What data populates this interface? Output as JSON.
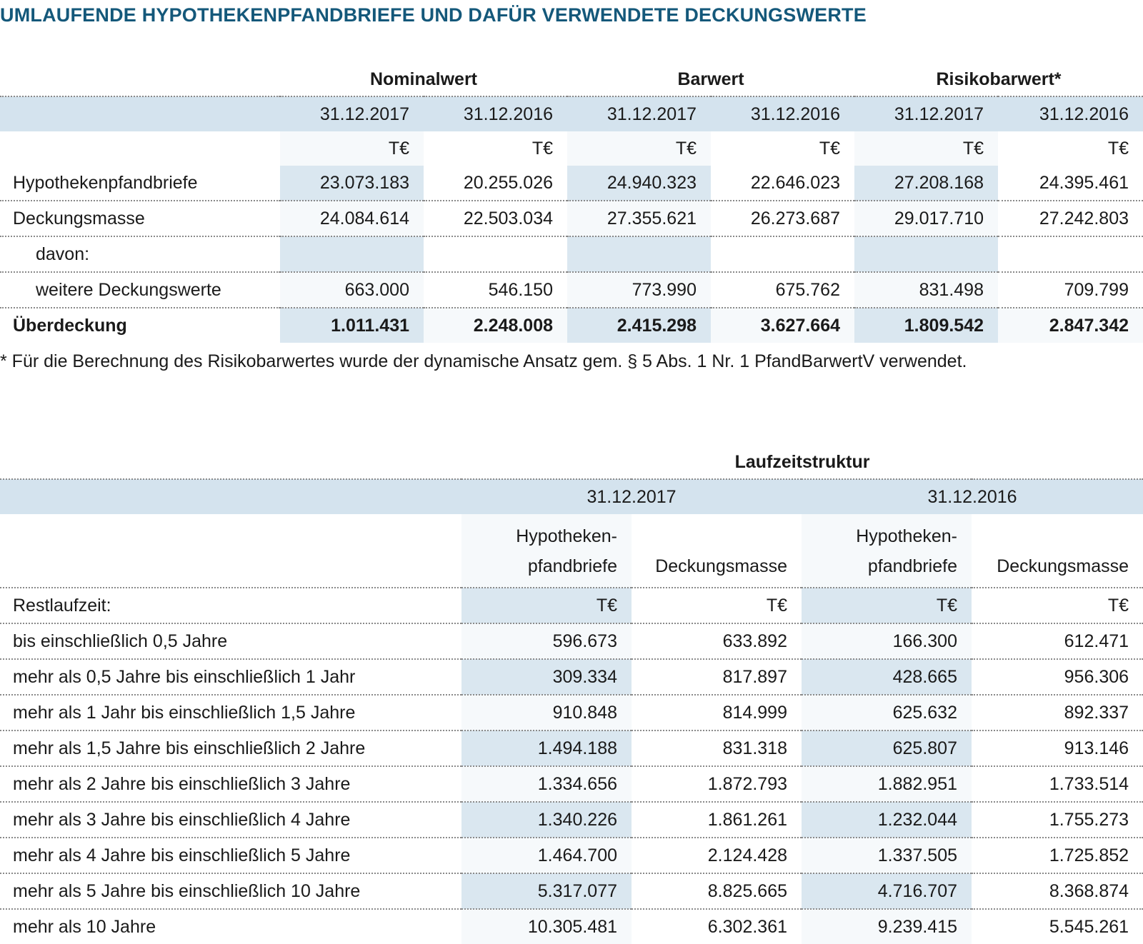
{
  "title": "UMLAUFENDE HYPOTHEKENPFANDBRIEFE UND DAFÜR VERWENDETE DECKUNGSWERTE",
  "table1": {
    "groups": [
      "Nominalwert",
      "Barwert",
      "Risikobarwert*"
    ],
    "dates": [
      "31.12.2017",
      "31.12.2016",
      "31.12.2017",
      "31.12.2016",
      "31.12.2017",
      "31.12.2016"
    ],
    "unit": "T€",
    "rows": [
      {
        "label": "Hypothekenpfandbriefe",
        "values": [
          "23.073.183",
          "20.255.026",
          "24.940.323",
          "22.646.023",
          "27.208.168",
          "24.395.461"
        ]
      },
      {
        "label": "Deckungsmasse",
        "values": [
          "24.084.614",
          "22.503.034",
          "27.355.621",
          "26.273.687",
          "29.017.710",
          "27.242.803"
        ]
      },
      {
        "label": "davon:",
        "values": [
          "",
          "",
          "",
          "",
          "",
          ""
        ]
      },
      {
        "label": "weitere Deckungswerte",
        "values": [
          "663.000",
          "546.150",
          "773.990",
          "675.762",
          "831.498",
          "709.799"
        ]
      },
      {
        "label": "Überdeckung",
        "values": [
          "1.011.431",
          "2.248.008",
          "2.415.298",
          "3.627.664",
          "1.809.542",
          "2.847.342"
        ]
      }
    ],
    "footnote": "* Für die Berechnung des Risikobarwertes wurde der dynamische Ansatz gem. § 5 Abs. 1 Nr. 1 PfandBarwertV verwendet."
  },
  "table2": {
    "group": "Laufzeitstruktur",
    "dates": [
      "31.12.2017",
      "31.12.2016"
    ],
    "headers": [
      "Hypotheken-\npfandbriefe",
      "Deckungsmasse",
      "Hypotheken-\npfandbriefe",
      "Deckungsmasse"
    ],
    "restlaufzeit": "Restlaufzeit:",
    "unit": "T€",
    "rows": [
      {
        "label": "bis einschließlich 0,5 Jahre",
        "values": [
          "596.673",
          "633.892",
          "166.300",
          "612.471"
        ]
      },
      {
        "label": "mehr als 0,5 Jahre bis einschließlich 1 Jahr",
        "values": [
          "309.334",
          "817.897",
          "428.665",
          "956.306"
        ]
      },
      {
        "label": "mehr als 1 Jahr bis einschließlich 1,5 Jahre",
        "values": [
          "910.848",
          "814.999",
          "625.632",
          "892.337"
        ]
      },
      {
        "label": "mehr als 1,5 Jahre bis einschließlich 2 Jahre",
        "values": [
          "1.494.188",
          "831.318",
          "625.807",
          "913.146"
        ]
      },
      {
        "label": "mehr als 2 Jahre bis einschließlich 3 Jahre",
        "values": [
          "1.334.656",
          "1.872.793",
          "1.882.951",
          "1.733.514"
        ]
      },
      {
        "label": "mehr als 3 Jahre bis einschließlich 4 Jahre",
        "values": [
          "1.340.226",
          "1.861.261",
          "1.232.044",
          "1.755.273"
        ]
      },
      {
        "label": "mehr als 4 Jahre bis einschließlich 5 Jahre",
        "values": [
          "1.464.700",
          "2.124.428",
          "1.337.505",
          "1.725.852"
        ]
      },
      {
        "label": "mehr als 5 Jahre bis einschließlich 10 Jahre",
        "values": [
          "5.317.077",
          "8.825.665",
          "4.716.707",
          "8.368.874"
        ]
      },
      {
        "label": "mehr als 10 Jahre",
        "values": [
          "10.305.481",
          "6.302.361",
          "9.239.415",
          "5.545.261"
        ]
      }
    ]
  }
}
